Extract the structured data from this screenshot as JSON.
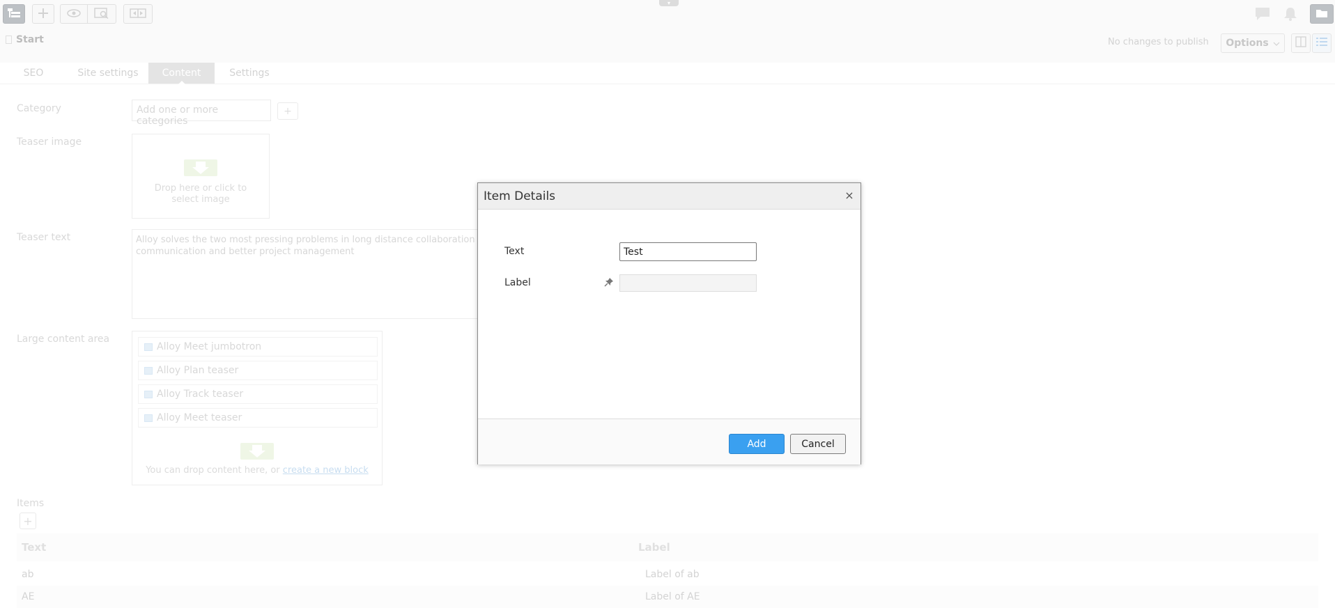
{
  "toolbar": {
    "icons": [
      "navigation-tree-icon",
      "add-icon",
      "preview-icon",
      "preview-zoom-icon",
      "compare-icon",
      "comments-icon",
      "notifications-icon",
      "assets-pane-icon"
    ],
    "collapse_glyph": "▾"
  },
  "breadcrumb": {
    "page_name": "Start"
  },
  "header": {
    "publish_status": "No changes to publish",
    "options_label": "Options"
  },
  "tabs": [
    {
      "label": "SEO",
      "active": false
    },
    {
      "label": "Site settings",
      "active": false
    },
    {
      "label": "Content",
      "active": true
    },
    {
      "label": "Settings",
      "active": false
    }
  ],
  "form": {
    "category": {
      "label": "Category",
      "placeholder": "Add one or more categories",
      "add_glyph": "+"
    },
    "teaser_image": {
      "label": "Teaser image",
      "drop_text": "Drop here or click to select image"
    },
    "teaser_text": {
      "label": "Teaser text",
      "value": "Alloy solves the two most pressing problems in long distance collaboration communication and better project management"
    },
    "large_content_area": {
      "label": "Large content area",
      "blocks": [
        "Alloy Meet jumbotron",
        "Alloy Plan teaser",
        "Alloy Track teaser",
        "Alloy Meet teaser"
      ],
      "drop_text": "You can drop content here, or ",
      "create_link": "create a new block"
    },
    "items": {
      "label": "Items",
      "add_glyph": "+",
      "columns": [
        "Text",
        "Label"
      ],
      "rows": [
        {
          "text": "ab",
          "label": "Label of ab"
        },
        {
          "text": "AE",
          "label": "Label of AE"
        }
      ]
    }
  },
  "dialog": {
    "title": "Item Details",
    "close_glyph": "×",
    "fields": {
      "text_label": "Text",
      "text_value": "Test",
      "label_label": "Label",
      "label_value": ""
    },
    "add_label": "Add",
    "cancel_label": "Cancel"
  },
  "colors": {
    "primary_button": "#3aa0f0",
    "active_tab": "#d6d6d6",
    "drop_zone_arrow": "#e7f1d9"
  }
}
